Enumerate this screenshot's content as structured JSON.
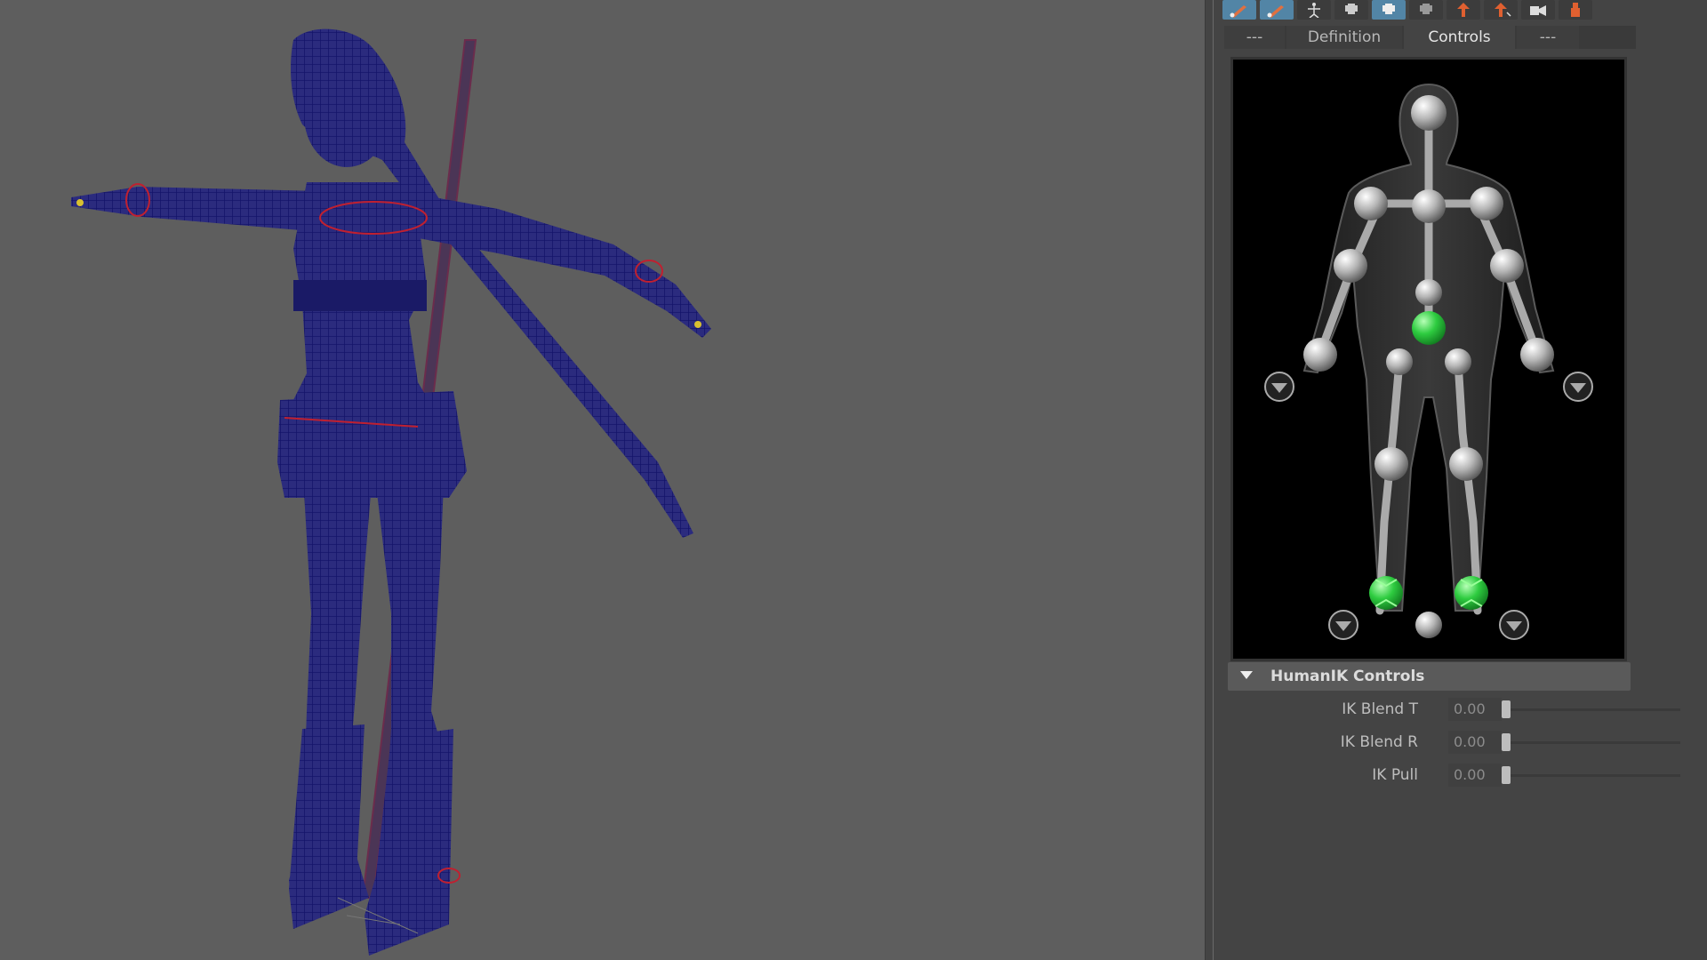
{
  "toolbar": {
    "icons": [
      "brush-tool-icon",
      "brush-tool-active-icon",
      "skeleton-icon",
      "character-icon",
      "character-selected-icon",
      "character-alt-icon",
      "orange-figure-icon",
      "orange-figure-2-icon",
      "key-icon",
      "orange-figure-3-icon"
    ]
  },
  "tabs": [
    {
      "label": "---"
    },
    {
      "label": "Definition"
    },
    {
      "label": "Controls"
    },
    {
      "label": "---"
    }
  ],
  "controls_section": {
    "title": "HumanIK Controls"
  },
  "attributes": [
    {
      "label": "IK Blend T",
      "value": "0.00"
    },
    {
      "label": "IK Blend R",
      "value": "0.00"
    },
    {
      "label": "IK Pull",
      "value": "0.00"
    }
  ],
  "colors": {
    "viewport_bg": "#5e5e5e",
    "wireframe": "#20208a",
    "effector_green": "#2ecc40",
    "active_tool": "#5285a6"
  }
}
